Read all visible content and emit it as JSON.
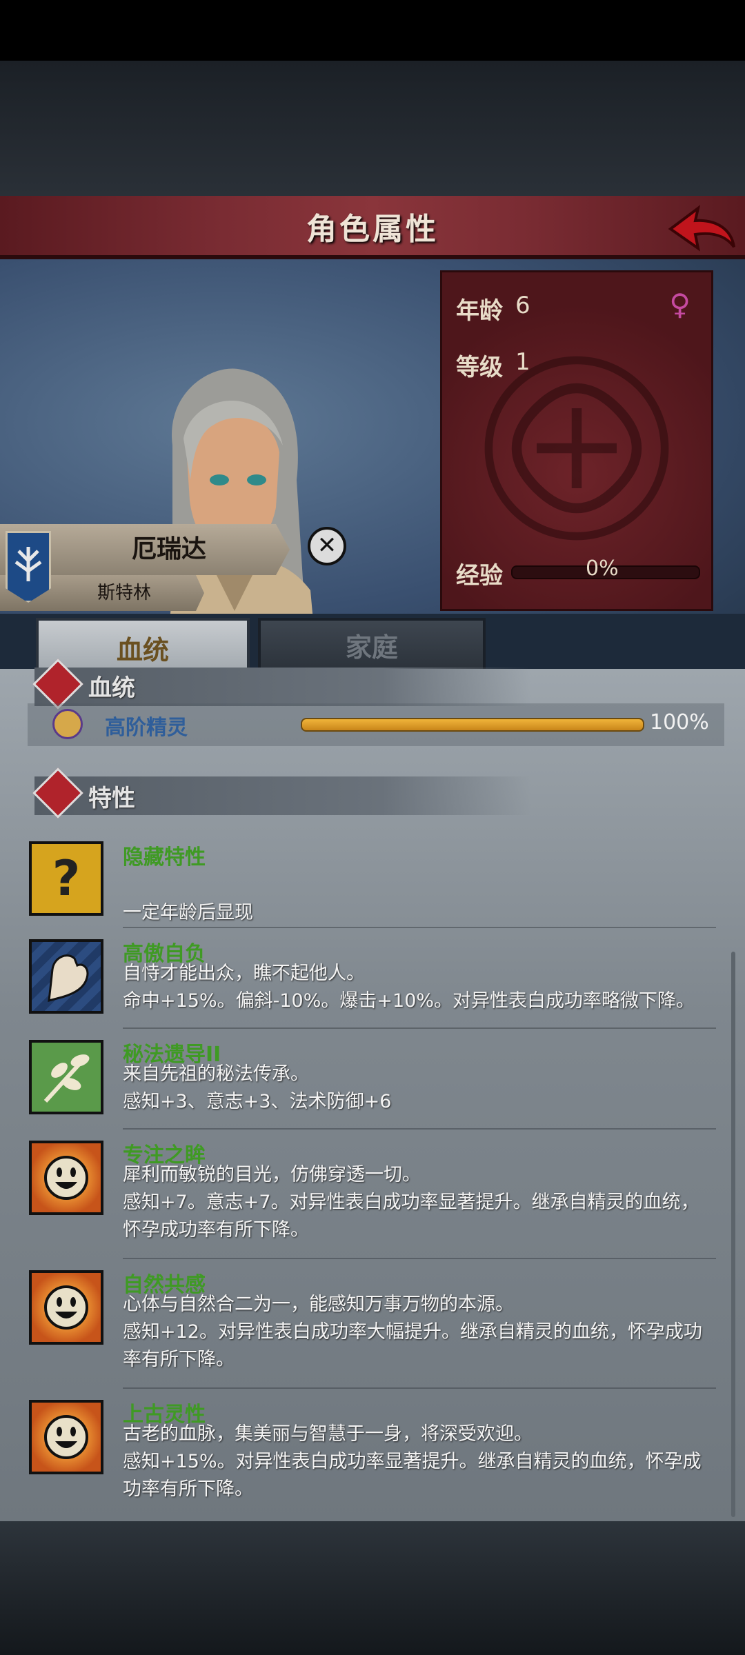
{
  "header": {
    "title": "角色属性"
  },
  "stats": {
    "age_label": "年龄",
    "age_value": "6",
    "level_label": "等级",
    "level_value": "1",
    "exp_label": "经验",
    "exp_value": "0%"
  },
  "character": {
    "name": "厄瑞达",
    "subtitle": "斯特林"
  },
  "tabs": [
    {
      "label": "血统"
    },
    {
      "label": "家庭"
    }
  ],
  "bloodline": {
    "title": "血统",
    "name": "高阶精灵",
    "percent_text": "100%",
    "percent": 1.0
  },
  "traits_section": {
    "title": "特性"
  },
  "traits": [
    {
      "name": "隐藏特性",
      "lines": [
        "",
        "一定年龄后显现"
      ],
      "icon": "question-mark-icon"
    },
    {
      "name": "高傲自负",
      "lines": [
        "自恃才能出众，瞧不起他人。",
        "命中+15%。偏斜-10%。爆击+10%。对异性表白成功率略微下降。"
      ],
      "icon": "flexed-arm-icon"
    },
    {
      "name": "秘法遗导II",
      "lines": [
        "来自先祖的秘法传承。",
        "感知+3、意志+3、法术防御+6"
      ],
      "icon": "leaf-branch-icon"
    },
    {
      "name": "专注之眸",
      "lines": [
        "犀利而敏锐的目光，仿佛穿透一切。",
        "感知+7。意志+7。对异性表白成功率显著提升。继承自精灵的血统，",
        "怀孕成功率有所下降。"
      ],
      "icon": "smiley-sun-icon"
    },
    {
      "name": "自然共感",
      "lines": [
        "心体与自然合二为一，能感知万事万物的本源。",
        "感知+12。对异性表白成功率大幅提升。继承自精灵的血统，怀孕成功",
        "率有所下降。"
      ],
      "icon": "smiley-sun-icon"
    },
    {
      "name": "上古灵性",
      "lines": [
        "古老的血脉，集美丽与智慧于一身，将深受欢迎。",
        "感知+15%。对异性表白成功率显著提升。继承自精灵的血统，怀孕成",
        "功率有所下降。"
      ],
      "icon": "smiley-sun-icon"
    }
  ],
  "colors": {
    "trait_name": "#3f9a24",
    "bloodline_name": "#2f5e9a",
    "title_bar": "#7a2c33"
  }
}
